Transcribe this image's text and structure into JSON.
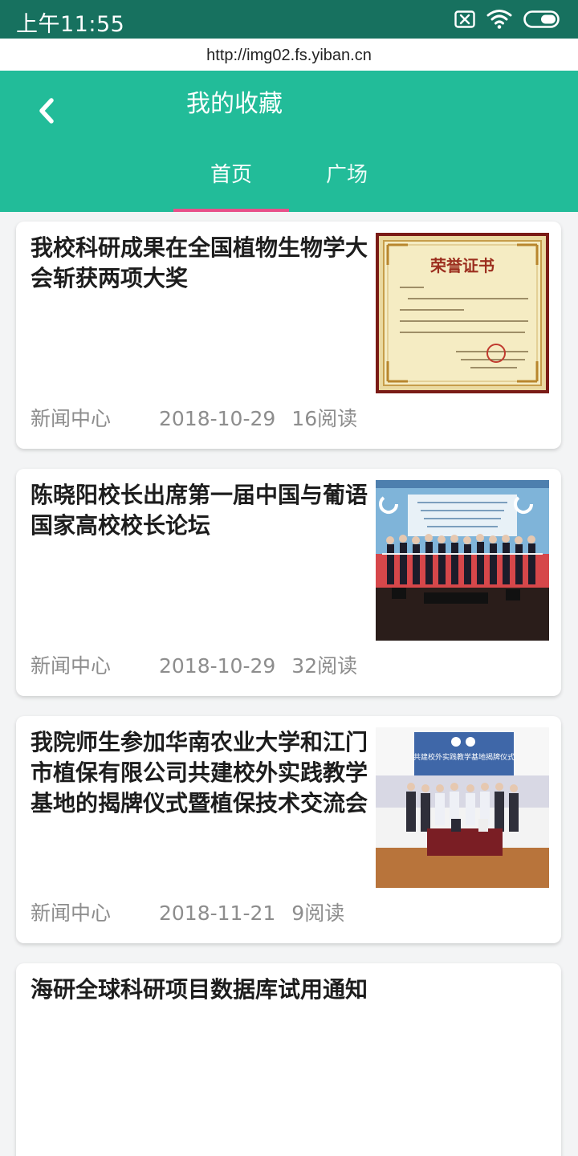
{
  "status_bar": {
    "time": "上午11:55",
    "icons": [
      "sim-off-icon",
      "wifi-icon",
      "battery-icon"
    ]
  },
  "url_bar": {
    "url": "http://img02.fs.yiban.cn"
  },
  "header": {
    "title": "我的收藏",
    "back_icon": "chevron-left-icon",
    "tabs": [
      {
        "label": "首页",
        "active": true
      },
      {
        "label": "广场",
        "active": false
      }
    ]
  },
  "colors": {
    "status_bar": "#17715f",
    "header": "#22bc99",
    "tab_indicator": "#e8508a",
    "background": "#f3f4f5"
  },
  "articles": [
    {
      "title": "我校科研成果在全国植物生物学大会斩获两项大奖",
      "source": "新闻中心",
      "date": "2018-10-29",
      "reads": "16阅读",
      "image": "certificate-photo",
      "image_text": "荣誉证书"
    },
    {
      "title": "陈晓阳校长出席第一届中国与葡语国家高校校长论坛",
      "source": "新闻中心",
      "date": "2018-10-29",
      "reads": "32阅读",
      "image": "ribbon-cutting-photo"
    },
    {
      "title": "我院师生参加华南农业大学和江门市植保有限公司共建校外实践教学基地的揭牌仪式暨植保技术交流会",
      "source": "新闻中心",
      "date": "2018-11-21",
      "reads": "9阅读",
      "image": "signing-ceremony-photo",
      "image_text": "共建校外实践教学基地揭牌仪式"
    },
    {
      "title": "海研全球科研项目数据库试用通知",
      "source": "",
      "date": "",
      "reads": "",
      "image": ""
    }
  ]
}
